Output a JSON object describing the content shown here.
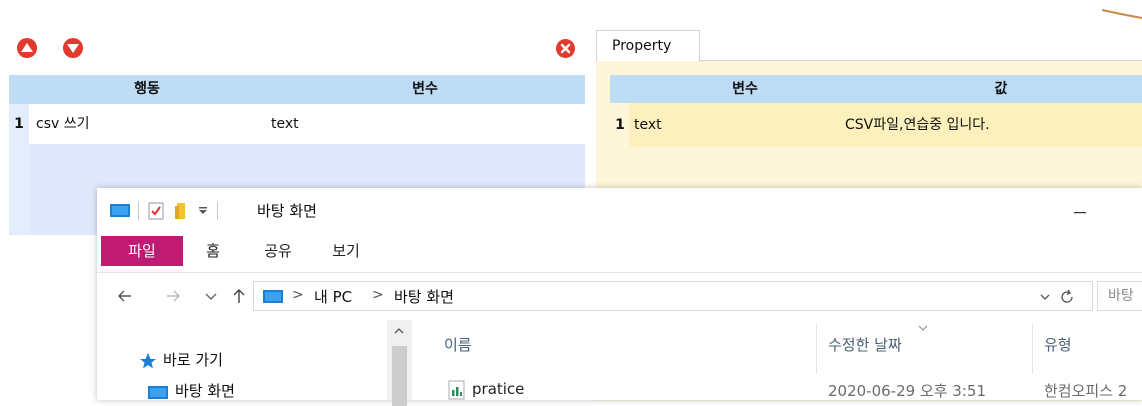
{
  "action_panel": {
    "headers": {
      "action": "행동",
      "variable": "변수"
    },
    "rows": [
      {
        "num": "1",
        "action": "csv 쓰기",
        "variable": "text"
      }
    ]
  },
  "property_panel": {
    "tab_label": "Property",
    "headers": {
      "variable": "변수",
      "value": "값"
    },
    "rows": [
      {
        "num": "1",
        "variable": "text",
        "value": "CSV파일,연습중 입니다."
      }
    ]
  },
  "explorer": {
    "title": "바탕 화면",
    "minimize_label": "—",
    "ribbon_tabs": {
      "file": "파일",
      "home": "홈",
      "share": "공유",
      "view": "보기"
    },
    "address": {
      "sep1": ">",
      "pc": "내 PC",
      "sep2": ">",
      "folder": "바탕 화면"
    },
    "search_placeholder": "바탕",
    "nav_pane": {
      "quick_access": "바로 가기",
      "desktop": "바탕 화면"
    },
    "columns": {
      "name": "이름",
      "modified": "수정한 날짜",
      "type": "유형"
    },
    "files": [
      {
        "name": "pratice",
        "modified": "2020-06-29 오후 3:51",
        "type": "한컴오피스 2"
      }
    ]
  },
  "colors": {
    "accent_red": "#e23a2e",
    "header_blue": "#bfdcf5",
    "ribbon_file": "#c01b72",
    "property_bg": "#fdf6d8"
  }
}
